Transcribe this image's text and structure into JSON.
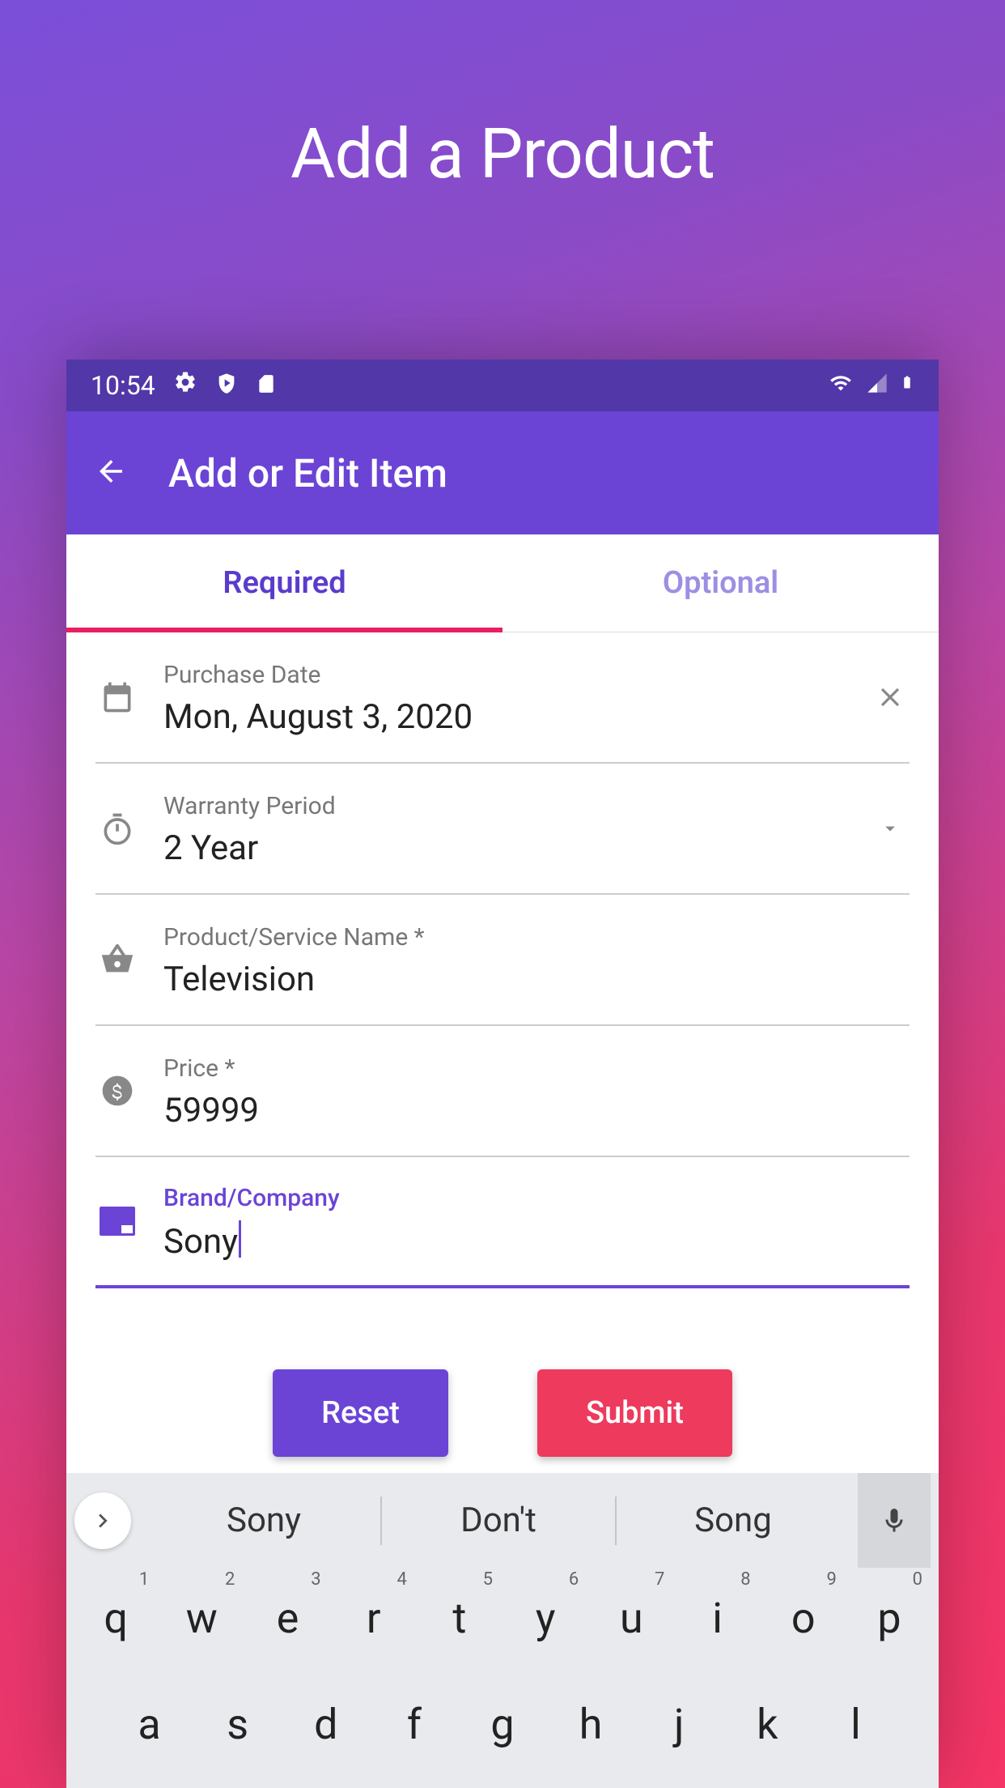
{
  "hero": {
    "title": "Add a Product"
  },
  "status": {
    "time": "10:54"
  },
  "appbar": {
    "title": "Add or Edit Item"
  },
  "tabs": {
    "required": "Required",
    "optional": "Optional"
  },
  "fields": {
    "purchase_date": {
      "label": "Purchase Date",
      "value": "Mon, August 3, 2020"
    },
    "warranty": {
      "label": "Warranty Period",
      "value": "2 Year"
    },
    "product_name": {
      "label": "Product/Service Name *",
      "value": "Television"
    },
    "price": {
      "label": "Price *",
      "value": "59999"
    },
    "brand": {
      "label": "Brand/Company",
      "value": "Sony"
    }
  },
  "buttons": {
    "reset": "Reset",
    "submit": "Submit"
  },
  "keyboard": {
    "suggestions": [
      "Sony",
      "Don't",
      "Song"
    ],
    "row1": [
      {
        "k": "q",
        "n": "1"
      },
      {
        "k": "w",
        "n": "2"
      },
      {
        "k": "e",
        "n": "3"
      },
      {
        "k": "r",
        "n": "4"
      },
      {
        "k": "t",
        "n": "5"
      },
      {
        "k": "y",
        "n": "6"
      },
      {
        "k": "u",
        "n": "7"
      },
      {
        "k": "i",
        "n": "8"
      },
      {
        "k": "o",
        "n": "9"
      },
      {
        "k": "p",
        "n": "0"
      }
    ],
    "row2": [
      {
        "k": "a"
      },
      {
        "k": "s"
      },
      {
        "k": "d"
      },
      {
        "k": "f"
      },
      {
        "k": "g"
      },
      {
        "k": "h"
      },
      {
        "k": "j"
      },
      {
        "k": "k"
      },
      {
        "k": "l"
      }
    ]
  }
}
